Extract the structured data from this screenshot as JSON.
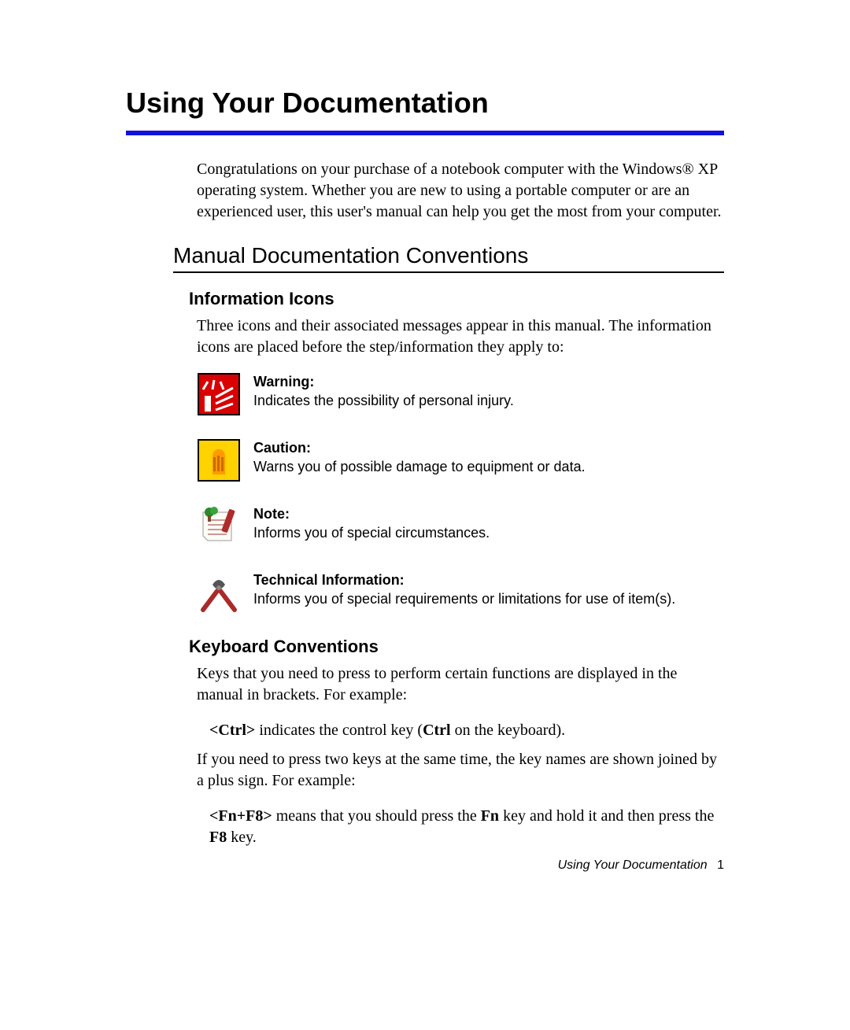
{
  "chapter_title": "Using Your Documentation",
  "intro_paragraph": "Congratulations on your purchase of a notebook computer with the Windows® XP operating system. Whether you are new to using a portable computer or are an experienced user, this user's manual can help you get the most from your computer.",
  "section1": {
    "title": "Manual Documentation Conventions",
    "sub1": {
      "title": "Information Icons",
      "lead": "Three icons and their associated messages appear in this manual. The information icons are placed before the step/information they apply to:",
      "icons": {
        "warning": {
          "label": "Warning:",
          "desc": "Indicates the possibility of personal injury."
        },
        "caution": {
          "label": "Caution:",
          "desc": "Warns you of possible damage to equipment or data."
        },
        "note": {
          "label": "Note:",
          "desc": "Informs you of special circumstances."
        },
        "tech": {
          "label": "Technical Information:",
          "desc": "Informs you of special requirements or limitations for use of item(s)."
        }
      }
    },
    "sub2": {
      "title": "Keyboard Conventions",
      "p1": "Keys that you need to press to perform certain functions are displayed in the manual in brackets. For example:",
      "ex1_pre": "<Ctrl>",
      "ex1_mid": " indicates the control key (",
      "ex1_bold": "Ctrl",
      "ex1_post": " on the keyboard).",
      "p2": "If you need to press two keys at the same time, the key names are shown joined by a plus sign. For example:",
      "ex2_pre": "<Fn+F8>",
      "ex2_a": " means that you should press the ",
      "ex2_b": "Fn",
      "ex2_c": " key and hold it and then press the ",
      "ex2_d": "F8",
      "ex2_e": " key."
    }
  },
  "footer": {
    "running": "Using Your Documentation",
    "page": "1"
  }
}
